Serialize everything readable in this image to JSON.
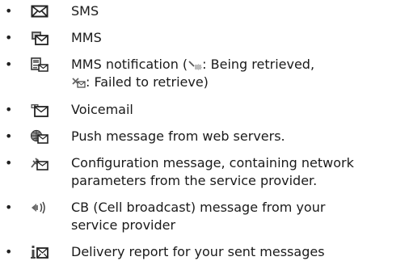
{
  "items": [
    {
      "icon": "sms-envelope-icon",
      "text": "SMS"
    },
    {
      "icon": "mms-icon",
      "text": "MMS"
    },
    {
      "icon": "mms-notification-icon",
      "text_before": "MMS notification (",
      "retrieving_icon": "retrieving-icon",
      "retrieving_label": ": Being retrieved,",
      "failed_icon": "failed-retrieve-icon",
      "failed_label": ": Failed to retrieve)"
    },
    {
      "icon": "voicemail-icon",
      "text": "Voicemail"
    },
    {
      "icon": "push-message-icon",
      "text": "Push message from web servers."
    },
    {
      "icon": "configuration-message-icon",
      "line1": "Configuration message, containing network",
      "line2": "parameters from the service provider."
    },
    {
      "icon": "cell-broadcast-icon",
      "line1": "CB (Cell broadcast) message from your",
      "line2": "service provider"
    },
    {
      "icon": "delivery-report-icon",
      "text": "Delivery report for your sent messages"
    }
  ]
}
